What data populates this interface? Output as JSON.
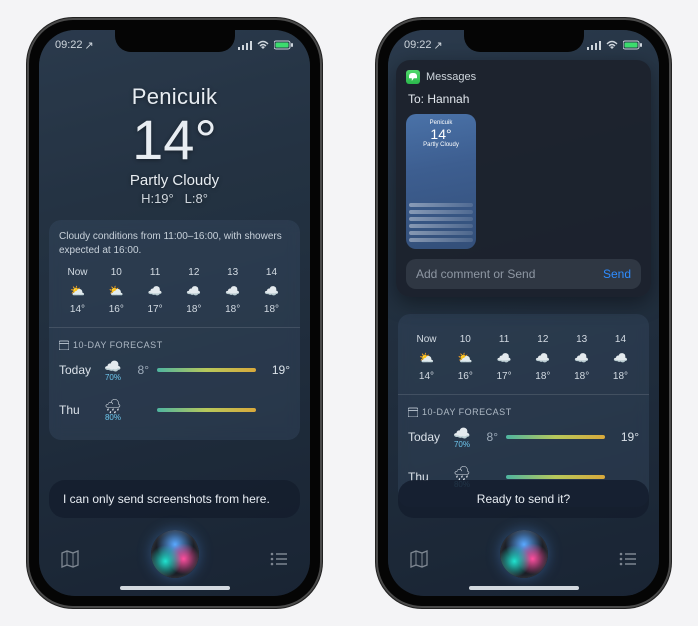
{
  "status": {
    "time": "09:22",
    "arrow": "↗"
  },
  "weather": {
    "location": "Penicuik",
    "temperature": "14°",
    "condition": "Partly Cloudy",
    "hi": "H:19°",
    "lo": "L:8°",
    "summary": "Cloudy conditions from 11:00–16:00, with showers expected at 16:00.",
    "hourly": [
      {
        "time": "Now",
        "icon": "⛅",
        "temp": "14°"
      },
      {
        "time": "10",
        "icon": "⛅",
        "temp": "16°"
      },
      {
        "time": "11",
        "icon": "☁️",
        "temp": "17°"
      },
      {
        "time": "12",
        "icon": "☁️",
        "temp": "18°"
      },
      {
        "time": "13",
        "icon": "☁️",
        "temp": "18°"
      },
      {
        "time": "14",
        "icon": "☁️",
        "temp": "18°"
      }
    ],
    "ten_header": "10-DAY FORECAST",
    "days": [
      {
        "label": "Today",
        "icon": "☁️",
        "pct": "70%",
        "lo": "8°",
        "hi": "19°"
      },
      {
        "label": "Thu",
        "icon": "🌧",
        "pct": "80%",
        "lo": "",
        "hi": ""
      }
    ]
  },
  "siri": {
    "left_message": "I can only send screenshots from here.",
    "right_message": "Ready to send it?"
  },
  "messages_panel": {
    "app_name": "Messages",
    "to_label": "To: Hannah",
    "input_placeholder": "Add comment or Send",
    "send_label": "Send",
    "thumb": {
      "location": "Penicuik",
      "temperature": "14°",
      "condition": "Partly Cloudy"
    }
  }
}
